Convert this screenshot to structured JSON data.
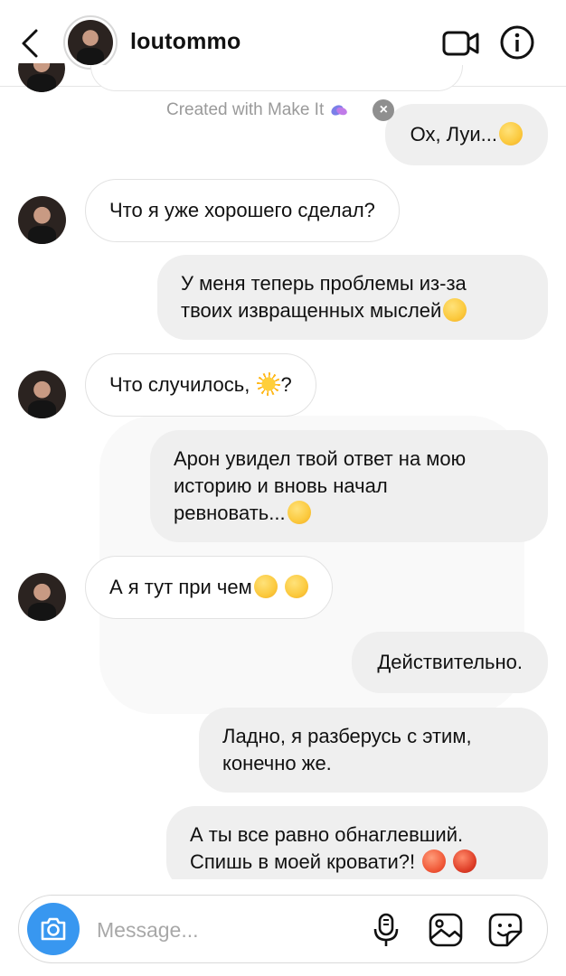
{
  "header": {
    "username": "loutommo",
    "back_icon": "chevron-left-icon",
    "video_icon": "video-call-icon",
    "info_icon": "info-icon"
  },
  "watermark": {
    "text": "Created with Make It",
    "close": "×"
  },
  "messages": [
    {
      "side": "out",
      "text": "Ох, Луи...",
      "emoji": [
        "shushing-face"
      ]
    },
    {
      "side": "in",
      "text": "Что я уже хорошего сделал?"
    },
    {
      "side": "out",
      "line1": "У меня теперь проблемы из-за",
      "line2": "твоих извращенных мыслей",
      "emoji": [
        "disappointed-face"
      ]
    },
    {
      "side": "in",
      "text_before": "Что случилось,",
      "text_after": "?",
      "emoji": [
        "sun"
      ]
    },
    {
      "side": "out",
      "line1": "Арон увидел твой ответ на мою",
      "line2": "историю и вновь начал",
      "line3": "ревновать...",
      "emoji": [
        "pleading-face"
      ]
    },
    {
      "side": "in",
      "text": "А я тут при чем",
      "emoji": [
        "tears-of-joy-face",
        "zany-face"
      ]
    },
    {
      "side": "out",
      "text": "Действительно."
    },
    {
      "side": "out",
      "line1": "Ладно, я разберусь с этим,",
      "line2": "конечно же."
    },
    {
      "side": "out",
      "line1": "А ты все равно обнаглевший.",
      "line2": "Спишь в моей кровати?!",
      "emoji": [
        "hot-face",
        "cursing-face"
      ]
    }
  ],
  "composer": {
    "placeholder": "Message...",
    "camera_icon": "camera-icon",
    "mic_icon": "microphone-icon",
    "gallery_icon": "gallery-icon",
    "sticker_icon": "sticker-icon"
  },
  "colors": {
    "accent": "#3897f0",
    "outgoing_bubble": "#efefef",
    "incoming_border": "#e2e2e2"
  }
}
